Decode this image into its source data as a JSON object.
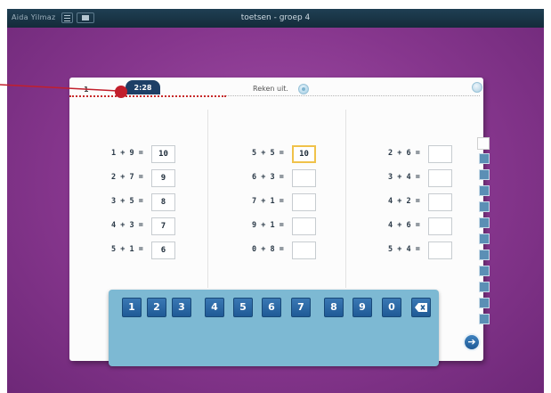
{
  "titlebar": {
    "user_name": "Aida Yilmaz",
    "menu_icon": "hamburger-menu-icon",
    "toggle_icon": "screen-toggle-icon",
    "title": "toetsen - groep 4"
  },
  "worksheet": {
    "sheet_number": "1",
    "timer": "2:28",
    "instruction": "Reken uit.",
    "audio_icon": "speaker-icon",
    "help_icon": "help-icon"
  },
  "columns": [
    {
      "rows": [
        {
          "expression": "1 + 9 =",
          "answer": "10"
        },
        {
          "expression": "2 + 7 =",
          "answer": "9"
        },
        {
          "expression": "3 + 5 =",
          "answer": "8"
        },
        {
          "expression": "4 + 3 =",
          "answer": "7"
        },
        {
          "expression": "5 + 1 =",
          "answer": "6"
        }
      ]
    },
    {
      "rows": [
        {
          "expression": "5 + 5 =",
          "answer": "10",
          "active": true
        },
        {
          "expression": "6 + 3 =",
          "answer": ""
        },
        {
          "expression": "7 + 1 =",
          "answer": ""
        },
        {
          "expression": "9 + 1 =",
          "answer": ""
        },
        {
          "expression": "0 + 8 =",
          "answer": ""
        }
      ]
    },
    {
      "rows": [
        {
          "expression": "2 + 6 =",
          "answer": ""
        },
        {
          "expression": "3 + 4 =",
          "answer": ""
        },
        {
          "expression": "4 + 2 =",
          "answer": ""
        },
        {
          "expression": "4 + 6 =",
          "answer": ""
        },
        {
          "expression": "5 + 4 =",
          "answer": ""
        }
      ]
    }
  ],
  "keypad": {
    "keys": [
      "1",
      "2",
      "3",
      "4",
      "5",
      "6",
      "7",
      "8",
      "9",
      "0"
    ],
    "backspace_icon": "backspace-icon"
  },
  "next_button": {
    "icon": "arrow-right-icon",
    "label": "➔"
  },
  "colors": {
    "background": "#86368d",
    "titlebar": "#1a3547",
    "timer_tab": "#1d3f66",
    "key": "#2d6aa6",
    "keypad": "#7db9d3",
    "active_border": "#f0c24a",
    "callout": "#c21f2c"
  }
}
